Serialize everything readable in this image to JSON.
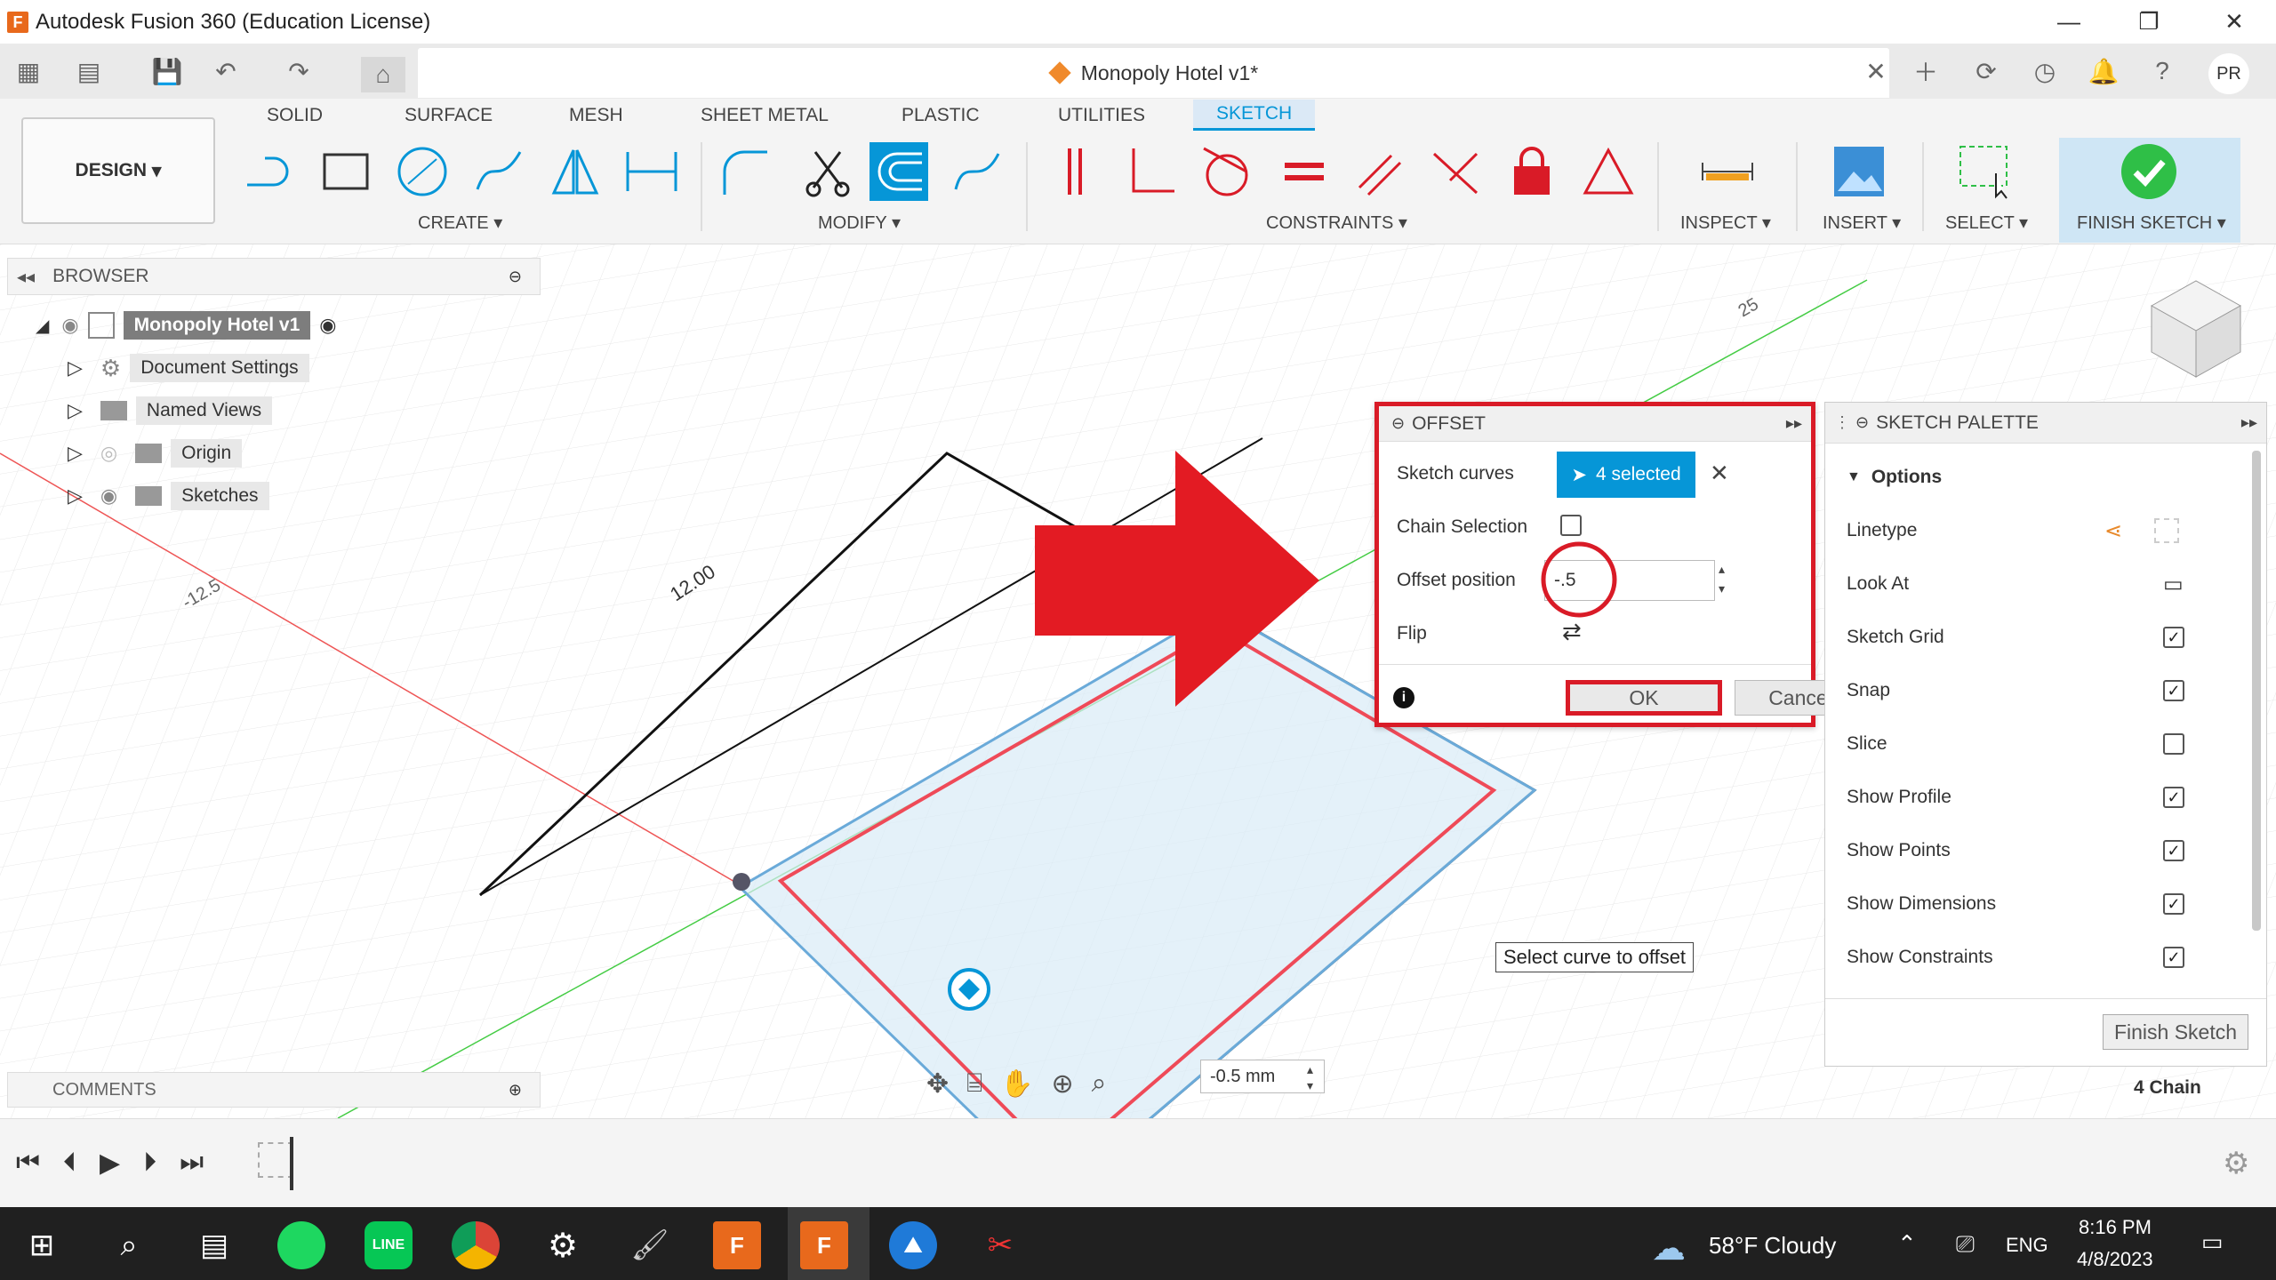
{
  "window": {
    "title": "Autodesk Fusion 360 (Education License)",
    "minimize_icon": "minimize-icon",
    "restore_icon": "restore-icon",
    "close_icon": "close-icon"
  },
  "document": {
    "tab_title": "Monopoly Hotel v1*",
    "user_initials": "PR"
  },
  "ribbon": {
    "workspace": "DESIGN",
    "tabs": [
      "SOLID",
      "SURFACE",
      "MESH",
      "SHEET METAL",
      "PLASTIC",
      "UTILITIES",
      "SKETCH"
    ],
    "active_tab": "SKETCH",
    "groups": {
      "create": "CREATE",
      "modify": "MODIFY",
      "constraints": "CONSTRAINTS",
      "inspect": "INSPECT",
      "insert": "INSERT",
      "select": "SELECT",
      "finish": "FINISH SKETCH"
    }
  },
  "browser": {
    "title": "BROWSER",
    "root": "Monopoly Hotel v1",
    "items": [
      {
        "label": "Document Settings"
      },
      {
        "label": "Named Views"
      },
      {
        "label": "Origin"
      },
      {
        "label": "Sketches"
      }
    ]
  },
  "comments": {
    "title": "COMMENTS"
  },
  "viewport": {
    "dimension_label": "12.00",
    "axis_label_left": "-12.5",
    "axis_label_top": "25",
    "tooltip": "Select curve to offset",
    "dim_input_value": "-0.5 mm",
    "status": "4 Chain"
  },
  "offset_dialog": {
    "title": "OFFSET",
    "sketch_curves_label": "Sketch curves",
    "selected_text": "4 selected",
    "chain_selection_label": "Chain Selection",
    "chain_selection_checked": false,
    "offset_position_label": "Offset position",
    "offset_value": "-.5",
    "flip_label": "Flip",
    "ok_label": "OK",
    "cancel_label": "Cancel"
  },
  "sketch_palette": {
    "title": "SKETCH PALETTE",
    "options_label": "Options",
    "rows": [
      {
        "label": "Linetype"
      },
      {
        "label": "Look At"
      },
      {
        "label": "Sketch Grid",
        "checked": true
      },
      {
        "label": "Snap",
        "checked": true
      },
      {
        "label": "Slice",
        "checked": false
      },
      {
        "label": "Show Profile",
        "checked": true
      },
      {
        "label": "Show Points",
        "checked": true
      },
      {
        "label": "Show Dimensions",
        "checked": true
      },
      {
        "label": "Show Constraints",
        "checked": true
      }
    ],
    "finish_button": "Finish Sketch"
  },
  "taskbar": {
    "weather": "58°F  Cloudy",
    "language": "ENG",
    "time": "8:16 PM",
    "date": "4/8/2023"
  },
  "colors": {
    "accent": "#0696d7",
    "highlight_red": "#d91b27",
    "finish_green": "#2fbf47"
  }
}
